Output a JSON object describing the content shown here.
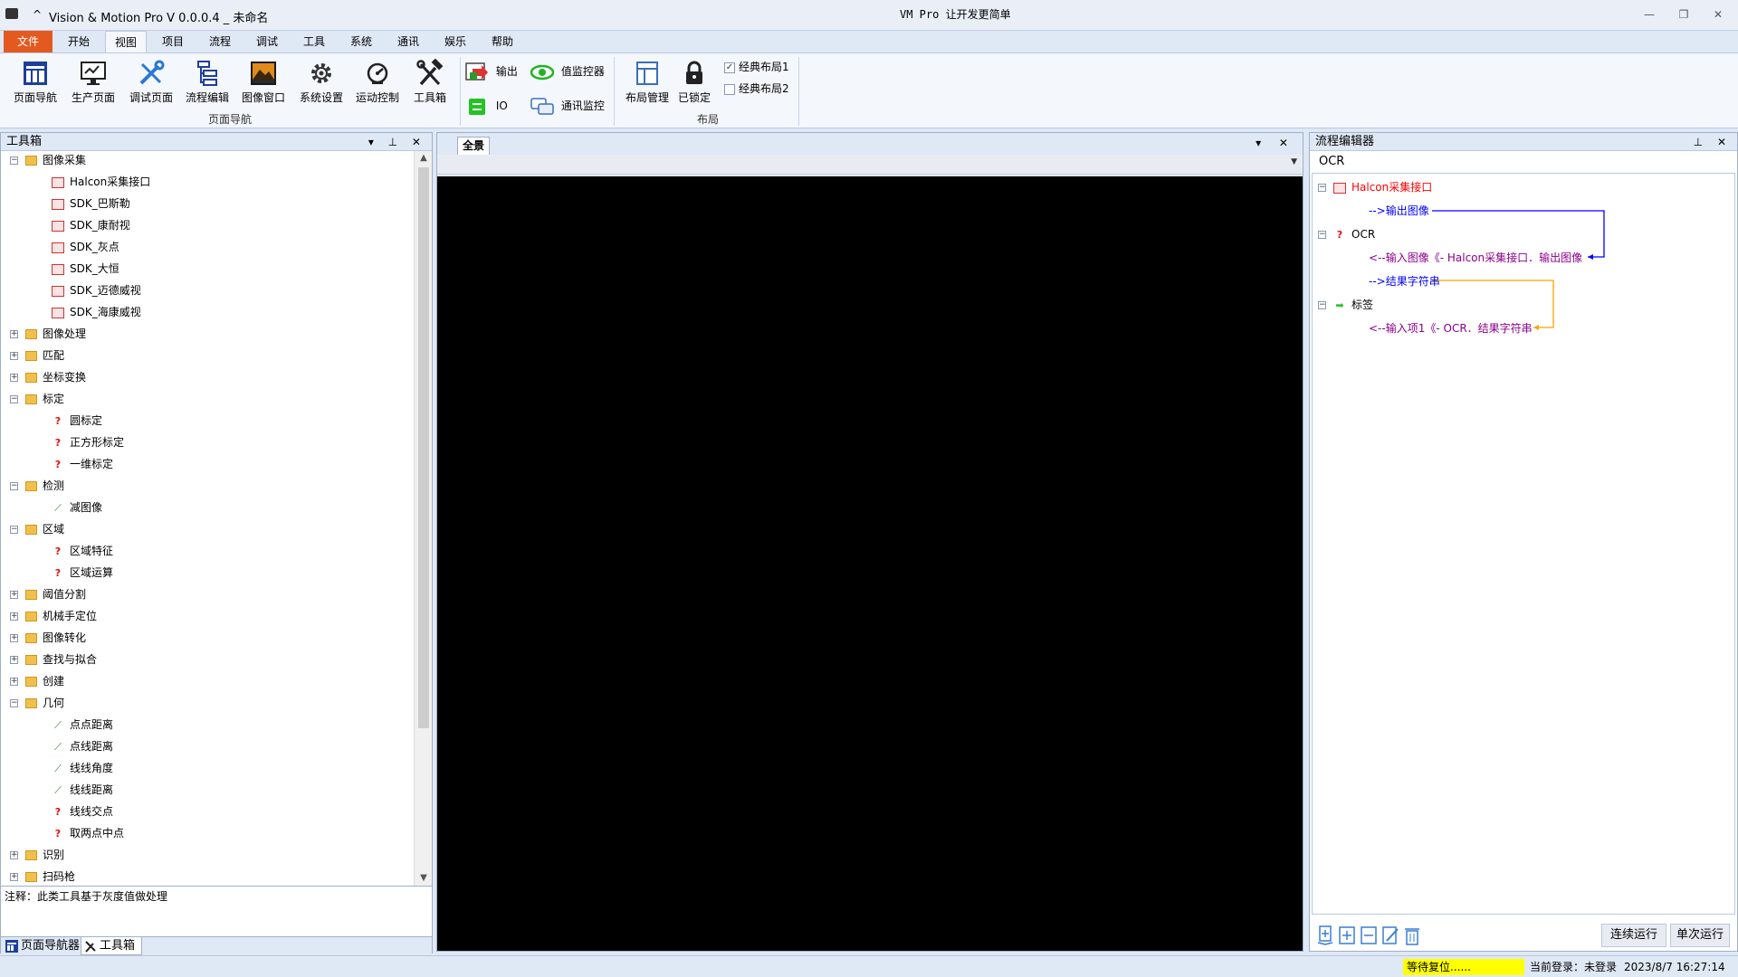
{
  "window": {
    "caret": "^",
    "title": "Vision & Motion Pro   V 0.0.0.4 _ 未命名",
    "center_title": "VM Pro 让开发更简单",
    "min": "—",
    "max": "❐",
    "close": "✕"
  },
  "menu": {
    "tabs": [
      "文件",
      "开始",
      "视图",
      "项目",
      "流程",
      "调试",
      "工具",
      "系统",
      "通讯",
      "娱乐",
      "帮助"
    ],
    "active": "视图"
  },
  "ribbon": {
    "page_nav_group": {
      "label": "页面导航",
      "buttons": [
        "页面导航",
        "生产页面",
        "调试页面",
        "流程编辑",
        "图像窗口",
        "系统设置",
        "运动控制",
        "工具箱"
      ]
    },
    "monitor_group": {
      "output": "输出",
      "value_monitor": "值监控器",
      "io": "IO",
      "comm_monitor": "通讯监控"
    },
    "layout_group": {
      "label": "布局",
      "layout_manage": "布局管理",
      "locked": "已锁定",
      "classic1": "经典布局1",
      "classic2": "经典布局2",
      "classic1_checked": true,
      "classic2_checked": false
    }
  },
  "toolbox": {
    "title": "工具箱",
    "tree": [
      {
        "label": "图像采集",
        "kind": "folder",
        "expanded": true
      },
      {
        "label": "Halcon采集接口",
        "kind": "cam"
      },
      {
        "label": "SDK_巴斯勒",
        "kind": "cam"
      },
      {
        "label": "SDK_康耐视",
        "kind": "cam"
      },
      {
        "label": "SDK_灰点",
        "kind": "cam"
      },
      {
        "label": "SDK_大恒",
        "kind": "cam"
      },
      {
        "label": "SDK_迈德威视",
        "kind": "cam"
      },
      {
        "label": "SDK_海康威视",
        "kind": "cam"
      },
      {
        "label": "图像处理",
        "kind": "folder",
        "expanded": false
      },
      {
        "label": "匹配",
        "kind": "folder",
        "expanded": false
      },
      {
        "label": "坐标变换",
        "kind": "folder",
        "expanded": false
      },
      {
        "label": "标定",
        "kind": "folder",
        "expanded": true
      },
      {
        "label": "圆标定",
        "kind": "q"
      },
      {
        "label": "正方形标定",
        "kind": "q"
      },
      {
        "label": "一维标定",
        "kind": "q"
      },
      {
        "label": "检测",
        "kind": "folder",
        "expanded": true
      },
      {
        "label": "减图像",
        "kind": "geo"
      },
      {
        "label": "区域",
        "kind": "folder",
        "expanded": true
      },
      {
        "label": "区域特征",
        "kind": "q"
      },
      {
        "label": "区域运算",
        "kind": "q"
      },
      {
        "label": "阈值分割",
        "kind": "folder",
        "expanded": false
      },
      {
        "label": "机械手定位",
        "kind": "folder",
        "expanded": false
      },
      {
        "label": "图像转化",
        "kind": "folder",
        "expanded": false
      },
      {
        "label": "查找与拟合",
        "kind": "folder",
        "expanded": false
      },
      {
        "label": "创建",
        "kind": "folder",
        "expanded": false
      },
      {
        "label": "几何",
        "kind": "folder",
        "expanded": true
      },
      {
        "label": "点点距离",
        "kind": "geo"
      },
      {
        "label": "点线距离",
        "kind": "geo"
      },
      {
        "label": "线线角度",
        "kind": "geo"
      },
      {
        "label": "线线距离",
        "kind": "geo"
      },
      {
        "label": "线线交点",
        "kind": "q"
      },
      {
        "label": "取两点中点",
        "kind": "q"
      },
      {
        "label": "识别",
        "kind": "folder",
        "expanded": false
      },
      {
        "label": "扫码枪",
        "kind": "folder",
        "expanded": false
      }
    ],
    "note": "注释：此类工具基于灰度值做处理",
    "bottom_tabs": [
      "页面导航器",
      "工具箱"
    ]
  },
  "canvas": {
    "tab": "全景"
  },
  "flow_editor": {
    "title": "流程编辑器",
    "tab": "OCR",
    "nodes": {
      "halcon": "Halcon采集接口",
      "halcon_out": "-->输出图像",
      "ocr": "OCR",
      "ocr_in": "<--输入图像《- Halcon采集接口．输出图像",
      "ocr_out": "-->结果字符串",
      "tag": "标签",
      "tag_in": "<--输入项1《- OCR．结果字符串"
    },
    "run_continuous": "连续运行",
    "run_once": "单次运行"
  },
  "status": {
    "wait": "等待复位......",
    "login": "当前登录：未登录",
    "datetime": "2023/8/7  16:27:14"
  },
  "colors": {
    "file_tab": "#e35a20",
    "halcon_node": "#ff0000",
    "output_link": "#0000ff",
    "input_link": "#8b008b",
    "ocr_link": "#ffa500",
    "status_wait": "#ffff00"
  }
}
